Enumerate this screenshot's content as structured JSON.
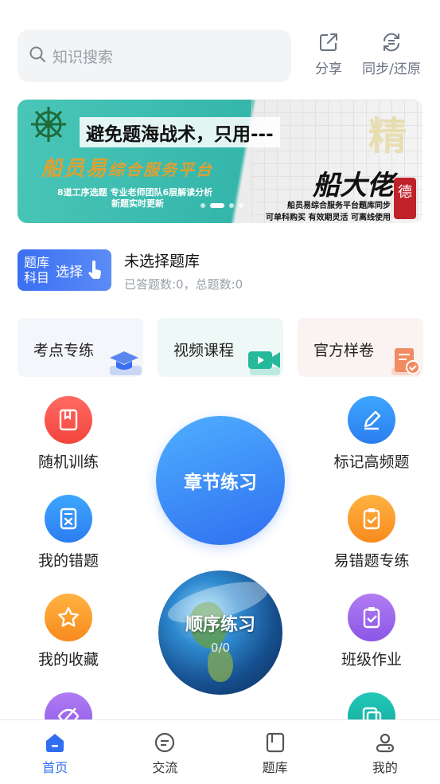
{
  "search": {
    "placeholder": "知识搜索"
  },
  "actions": {
    "share": "分享",
    "sync": "同步/还原"
  },
  "banner": {
    "headline": "避免题海战术，只用---",
    "brand": "船员易",
    "brand_suffix": "综合服务平台",
    "desc1": "8道工序选题 专业老师团队6层解读分析",
    "desc2": "新题实时更新",
    "big_char": "精",
    "right_brand": "船大佬",
    "right_desc1": "船员易综合服务平台题库同步",
    "right_desc2": "可单科购买 有效期灵活 可离线使用",
    "seal": "德",
    "active_slide": 2,
    "slide_count": 4
  },
  "bank": {
    "button_line1": "题库",
    "button_line2": "科目",
    "button_select": "选择",
    "title": "未选择题库",
    "answered_label": "已答题数:0",
    "total_label": "总题数:0",
    "separator": "，"
  },
  "features": [
    {
      "label": "考点专练"
    },
    {
      "label": "视频课程"
    },
    {
      "label": "官方样卷"
    }
  ],
  "grid": {
    "random": "随机训练",
    "mark": "标记高频题",
    "wrong": "我的错题",
    "easy_wrong": "易错题专练",
    "fav": "我的收藏",
    "class_work": "班级作业"
  },
  "chapter": {
    "label": "章节练习"
  },
  "sequence": {
    "label": "顺序练习",
    "progress": "0/0"
  },
  "tabs": [
    {
      "label": "首页",
      "active": true
    },
    {
      "label": "交流",
      "active": false
    },
    {
      "label": "题库",
      "active": false
    },
    {
      "label": "我的",
      "active": false
    }
  ],
  "colors": {
    "accent": "#2f6ef0",
    "banner_teal": "#3fbfb1"
  }
}
